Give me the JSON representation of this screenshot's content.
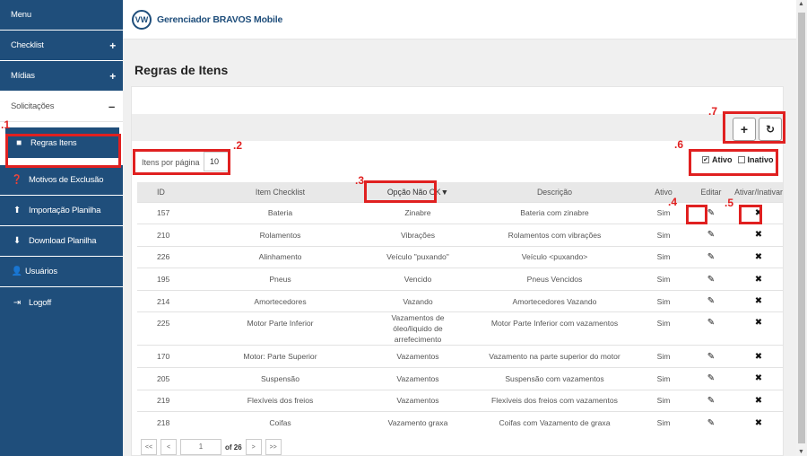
{
  "app": {
    "title": "Gerenciador BRAVOS Mobile",
    "logo": "VW"
  },
  "sidebar": {
    "menu_label": "Menu",
    "checklist": "Checklist",
    "midias": "Mídias",
    "solicitacoes": "Solicitações",
    "regras": "Regras Itens",
    "motivos": "Motivos de Exclusão",
    "importacao": "Importação Planilha",
    "download": "Download Planilha",
    "usuarios": "Usuários",
    "logoff": "Logoff"
  },
  "page": {
    "title": "Regras de Itens"
  },
  "controls": {
    "items_per_page_label": "Itens por página",
    "items_per_page_value": "10",
    "ativo_label": "Ativo",
    "inativo_label": "Inativo",
    "ativo_checked": true,
    "inativo_checked": false
  },
  "table": {
    "headers": {
      "id": "ID",
      "item": "Item Checklist",
      "opcao": "Opção Não OK▼",
      "descricao": "Descrição",
      "ativo": "Ativo",
      "editar": "Editar",
      "ativar": "Ativar/Inativar"
    },
    "rows": [
      {
        "id": "157",
        "item": "Bateria",
        "opcao": "Zinabre",
        "descricao": "Bateria com zinabre",
        "ativo": "Sim"
      },
      {
        "id": "210",
        "item": "Rolamentos",
        "opcao": "Vibrações",
        "descricao": "Rolamentos com vibrações",
        "ativo": "Sim"
      },
      {
        "id": "226",
        "item": "Alinhamento",
        "opcao": "Veículo \"puxando\"",
        "descricao": "Veículo <puxando>",
        "ativo": "Sim"
      },
      {
        "id": "195",
        "item": "Pneus",
        "opcao": "Vencido",
        "descricao": "Pneus Vencidos",
        "ativo": "Sim"
      },
      {
        "id": "214",
        "item": "Amortecedores",
        "opcao": "Vazando",
        "descricao": "Amortecedores Vazando",
        "ativo": "Sim"
      },
      {
        "id": "225",
        "item": "Motor Parte Inferior",
        "opcao": "Vazamentos de óleo/liquido de arrefecimento",
        "descricao": "Motor Parte Inferior com vazamentos",
        "ativo": "Sim"
      },
      {
        "id": "170",
        "item": "Motor: Parte Superior",
        "opcao": "Vazamentos",
        "descricao": "Vazamento na parte superior do motor",
        "ativo": "Sim"
      },
      {
        "id": "205",
        "item": "Suspensão",
        "opcao": "Vazamentos",
        "descricao": "Suspensão com vazamentos",
        "ativo": "Sim"
      },
      {
        "id": "219",
        "item": "Flexíveis dos freios",
        "opcao": "Vazamentos",
        "descricao": "Flexíveis dos freios com vazamentos",
        "ativo": "Sim"
      },
      {
        "id": "218",
        "item": "Coifas",
        "opcao": "Vazamento graxa",
        "descricao": "Coifas com Vazamento de graxa",
        "ativo": "Sim"
      }
    ]
  },
  "pager": {
    "first": "<<",
    "prev": "<",
    "current": "1",
    "of": "of 26",
    "next": ">",
    "last": ">>"
  },
  "annotations": {
    "n1": ".1",
    "n2": ".2",
    "n3": ".3",
    "n4": ".4",
    "n5": ".5",
    "n6": ".6",
    "n7": ".7"
  },
  "colors": {
    "sidebar": "#1f4e7b",
    "annotation": "#e02020"
  }
}
